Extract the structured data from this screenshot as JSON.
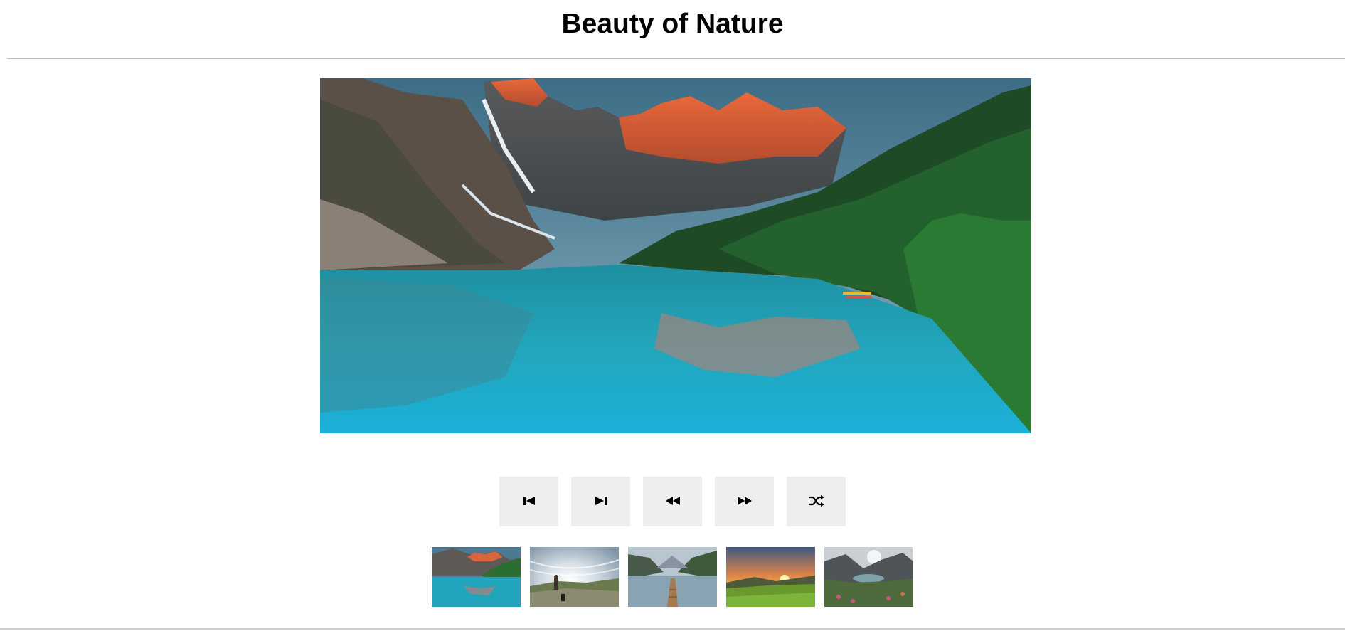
{
  "page": {
    "title": "Beauty of Nature"
  },
  "main_image": {
    "subject": "mountain-lake-sunrise"
  },
  "controls": [
    {
      "name": "first",
      "icon": "skip-first-icon"
    },
    {
      "name": "last",
      "icon": "skip-last-icon"
    },
    {
      "name": "previous",
      "icon": "rewind-icon"
    },
    {
      "name": "next",
      "icon": "fast-forward-icon"
    },
    {
      "name": "shuffle",
      "icon": "shuffle-icon"
    }
  ],
  "thumbnails": [
    {
      "subject": "mountain-lake",
      "selected": true
    },
    {
      "subject": "hiker-dramatic-sky"
    },
    {
      "subject": "lake-dock-valley"
    },
    {
      "subject": "sunset-meadow"
    },
    {
      "subject": "alpine-lake-flowers"
    }
  ],
  "colors": {
    "button_bg": "#eeeeee",
    "rule": "#bdbdbd",
    "title_text": "#000000"
  }
}
